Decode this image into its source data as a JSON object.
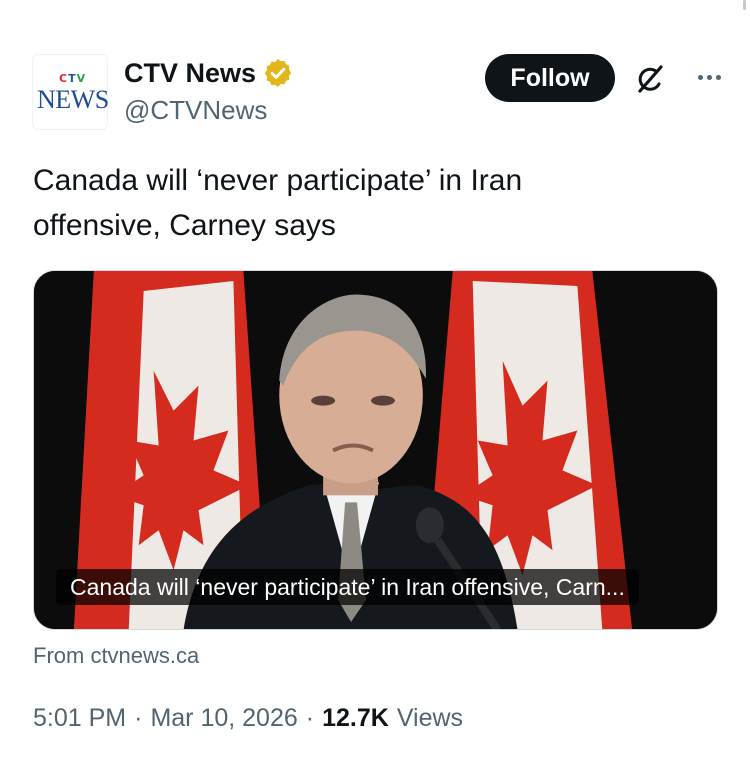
{
  "account": {
    "display_name": "CTV News",
    "handle": "@CTVNews",
    "verified": true,
    "avatar_text": {
      "ctv": "CTV",
      "news": "NEWS"
    }
  },
  "actions": {
    "follow_label": "Follow",
    "grok_icon": "grok-icon",
    "more_icon": "more-icon"
  },
  "tweet": {
    "text": "Canada will ‘never participate’ in Iran offensive, Carney says",
    "card": {
      "caption": "Canada will ‘never participate’ in Iran offensive, Carn...",
      "image_icon": "news-photo"
    },
    "source": "From ctvnews.ca",
    "time": "5:01 PM",
    "separator": "·",
    "date": "Mar 10, 2026",
    "views_count": "12.7K",
    "views_label": "Views"
  },
  "colors": {
    "text_primary": "#0f1419",
    "text_secondary": "#536471",
    "verified_gold": "#e2b719",
    "flag_red": "#d52b1e"
  }
}
